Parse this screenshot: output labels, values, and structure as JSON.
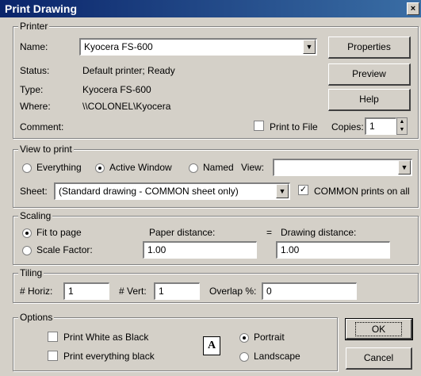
{
  "window": {
    "title": "Print Drawing",
    "close_glyph": "×"
  },
  "printer": {
    "legend": "Printer",
    "name_label": "Name:",
    "name_value": "Kyocera FS-600",
    "status_label": "Status:",
    "status_value": "Default printer; Ready",
    "type_label": "Type:",
    "type_value": "Kyocera FS-600",
    "where_label": "Where:",
    "where_value": "\\\\COLONEL\\Kyocera",
    "comment_label": "Comment:",
    "print_to_file_label": "Print to File",
    "print_to_file_checked": false,
    "copies_label": "Copies:",
    "copies_value": "1",
    "properties_label": "Properties",
    "preview_label": "Preview",
    "help_label": "Help"
  },
  "view_to_print": {
    "legend": "View to print",
    "everything_label": "Everything",
    "active_window_label": "Active Window",
    "named_view_label": "Named",
    "view_label": "View:",
    "selected": "active_window",
    "view_value": "",
    "sheet_label": "Sheet:",
    "sheet_value": "(Standard drawing - COMMON sheet only)",
    "common_prints_label": "COMMON prints on all",
    "common_prints_checked": true
  },
  "scaling": {
    "legend": "Scaling",
    "fit_to_page_label": "Fit to page",
    "scale_factor_label": "Scale Factor:",
    "selected": "fit_to_page",
    "paper_distance_label": "Paper distance:",
    "equals": "=",
    "drawing_distance_label": "Drawing distance:",
    "paper_distance_value": "1.00",
    "drawing_distance_value": "1.00"
  },
  "tiling": {
    "legend": "Tiling",
    "horiz_label": "# Horiz:",
    "horiz_value": "1",
    "vert_label": "# Vert:",
    "vert_value": "1",
    "overlap_label": "Overlap %:",
    "overlap_value": "0"
  },
  "options": {
    "legend": "Options",
    "print_white_label": "Print White as Black",
    "print_black_label": "Print everything black",
    "orientation_icon_glyph": "A",
    "portrait_label": "Portrait",
    "landscape_label": "Landscape",
    "orientation": "portrait"
  },
  "buttons": {
    "ok_label": "OK",
    "cancel_label": "Cancel"
  }
}
